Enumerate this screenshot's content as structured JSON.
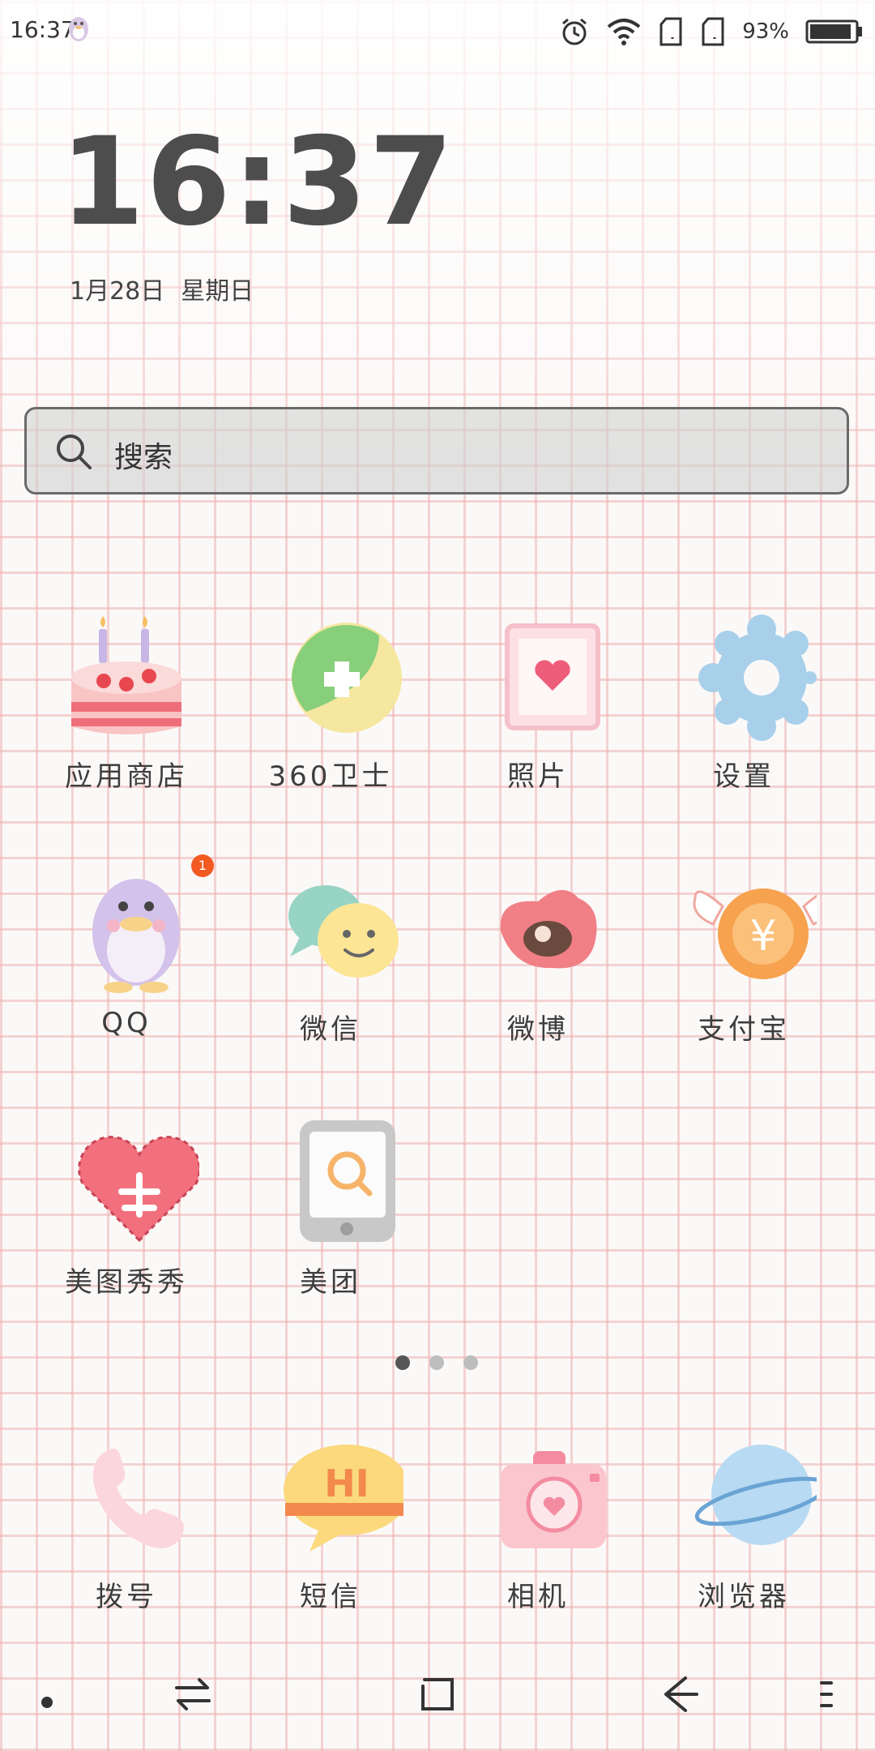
{
  "status_bar": {
    "time": "16:37",
    "icons": [
      "qq-penguin-icon",
      "alarm-icon",
      "wifi-icon",
      "sim-card-icon",
      "sim-card-icon",
      "battery-icon"
    ],
    "battery_percent": "93%",
    "battery_level": 0.93
  },
  "clock": {
    "time": "16:37",
    "date": "1月28日",
    "weekday": "星期日"
  },
  "search": {
    "label": "搜索"
  },
  "apps": [
    {
      "label": "应用商店",
      "icon": "cake-icon"
    },
    {
      "label": "360卫士",
      "icon": "shield-cross-icon"
    },
    {
      "label": "照片",
      "icon": "heart-photo-icon"
    },
    {
      "label": "设置",
      "icon": "gear-icon"
    },
    {
      "label": "QQ",
      "icon": "penguin-icon",
      "badge": "1"
    },
    {
      "label": "微信",
      "icon": "chat-bubbles-icon"
    },
    {
      "label": "微博",
      "icon": "weibo-eye-icon"
    },
    {
      "label": "支付宝",
      "icon": "winged-coin-icon"
    },
    {
      "label": "美图秀秀",
      "icon": "stitched-heart-icon"
    },
    {
      "label": "美团",
      "icon": "phone-search-icon"
    }
  ],
  "page_indicator": {
    "count": 3,
    "active": 1
  },
  "dock": [
    {
      "label": "拨号",
      "icon": "phone-handset-icon"
    },
    {
      "label": "短信",
      "icon": "hi-bubble-icon"
    },
    {
      "label": "相机",
      "icon": "camera-icon"
    },
    {
      "label": "浏览器",
      "icon": "planet-icon"
    }
  ],
  "navigation_bar": [
    "dot-icon",
    "switch-arrows-icon",
    "home-square-icon",
    "back-arrow-icon",
    "menu-icon"
  ],
  "colors": {
    "grid": "#eeb2b2",
    "badge": "#f25a22",
    "search_border": "#6a6a6a"
  }
}
